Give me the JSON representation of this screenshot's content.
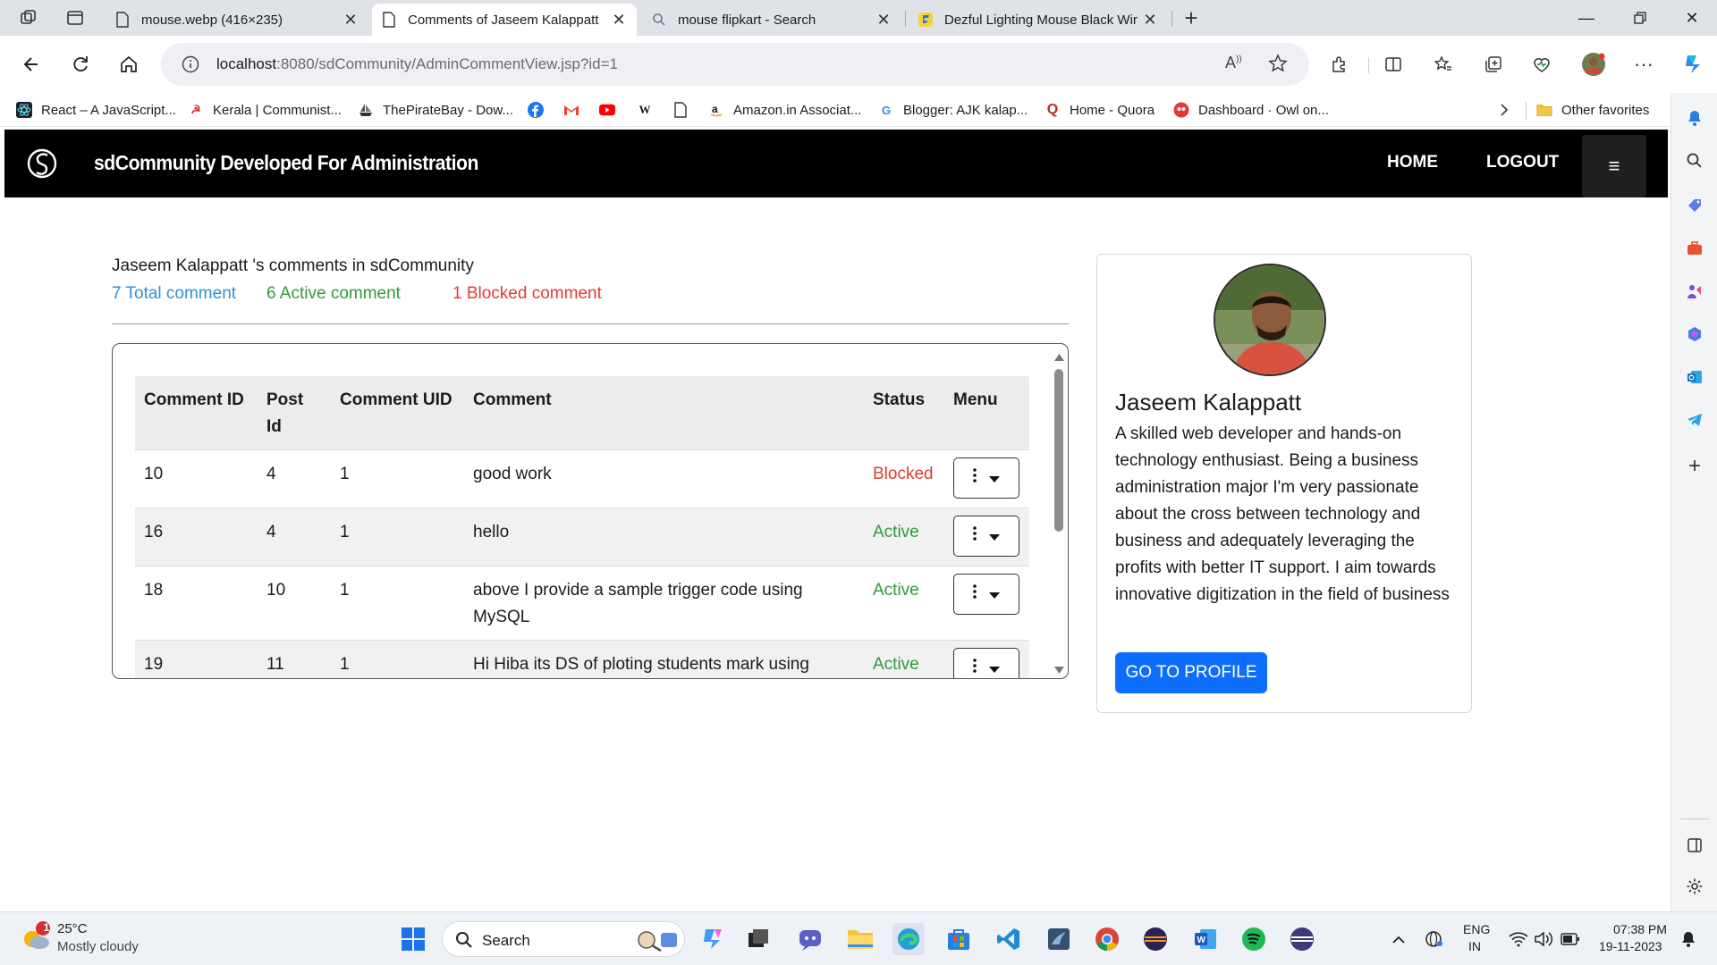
{
  "browser": {
    "tabs": [
      {
        "label": "mouse.webp (416×235)",
        "icon": "document-icon",
        "active": false
      },
      {
        "label": "Comments of Jaseem Kalappatt",
        "icon": "document-icon",
        "active": true
      },
      {
        "label": "mouse flipkart - Search",
        "icon": "search-icon",
        "active": false
      },
      {
        "label": "Dezful Lighting Mouse Black Wir",
        "icon": "flipkart-icon",
        "active": false
      }
    ],
    "url_host": "localhost",
    "url_rest": ":8080/sdCommunity/AdminCommentView.jsp?id=1",
    "bookmarks": [
      {
        "label": "React – A JavaScript...",
        "icon": "react-icon"
      },
      {
        "label": "Kerala | Communist...",
        "icon": "hammer-sickle-icon"
      },
      {
        "label": "ThePirateBay - Dow...",
        "icon": "pirate-ship-icon"
      },
      {
        "label": "",
        "icon": "facebook-icon"
      },
      {
        "label": "",
        "icon": "gmail-icon"
      },
      {
        "label": "",
        "icon": "youtube-icon"
      },
      {
        "label": "",
        "icon": "wikipedia-icon"
      },
      {
        "label": "",
        "icon": "document-icon"
      },
      {
        "label": "Amazon.in Associat...",
        "icon": "amazon-icon"
      },
      {
        "label": "Blogger: AJK kalap...",
        "icon": "google-icon"
      },
      {
        "label": "Home - Quora",
        "icon": "quora-icon"
      },
      {
        "label": "Dashboard · Owl on...",
        "icon": "owl-icon"
      }
    ],
    "other_favorites": "Other favorites"
  },
  "site": {
    "title": "sdCommunity Developed For Administration",
    "nav_home": "HOME",
    "nav_logout": "LOGOUT",
    "menu_glyph": "≡"
  },
  "main": {
    "heading": "Jaseem Kalappatt 's comments in sdCommunity",
    "stats": {
      "total": "7 Total comment",
      "active": "6 Active comment",
      "blocked": "1 Blocked comment"
    },
    "colors": {
      "total": "#2f8fd8",
      "active": "#2e9a3b",
      "blocked": "#e53935",
      "primary": "#0d6efd"
    },
    "table": {
      "headers": [
        "Comment ID",
        "Post Id",
        "Comment UID",
        "Comment",
        "Status",
        "Menu"
      ],
      "rows": [
        {
          "id": "10",
          "post": "4",
          "uid": "1",
          "comment": "good work",
          "status": "Blocked"
        },
        {
          "id": "16",
          "post": "4",
          "uid": "1",
          "comment": "hello",
          "status": "Active"
        },
        {
          "id": "18",
          "post": "10",
          "uid": "1",
          "comment": "above I provide a sample trigger code using MySQL",
          "status": "Active"
        },
        {
          "id": "19",
          "post": "11",
          "uid": "1",
          "comment": "Hi Hiba its DS of ploting students mark using",
          "status": "Active"
        }
      ]
    }
  },
  "profile": {
    "name": "Jaseem Kalappatt",
    "bio": "A skilled web developer and hands-on technology enthusiast. Being a business administration major I'm very passionate about the cross between technology and business and adequately leveraging the profits with better IT support. I aim towards innovative digitization in the field of business",
    "button": "GO TO PROFILE"
  },
  "taskbar": {
    "weather_temp": "25°C",
    "weather_desc": "Mostly cloudy",
    "weather_badge": "1",
    "search_label": "Search",
    "lang_top": "ENG",
    "lang_bottom": "IN",
    "time": "07:38 PM",
    "date": "19-11-2023"
  }
}
